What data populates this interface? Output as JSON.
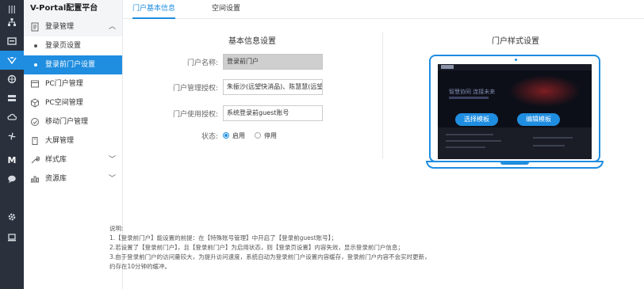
{
  "colors": {
    "accent": "#1f8de0",
    "rail": "#2a313d"
  },
  "rail": {
    "icons": [
      "grid-menu-icon",
      "org-tree-icon",
      "monitor-board-icon",
      "portal-config-icon",
      "network-icon",
      "storage-icon",
      "cloud-icon",
      "fan-icon",
      "m-letter-icon",
      "chat-icon",
      "gear-icon",
      "laptop-icon"
    ],
    "m_label": "M"
  },
  "sidebar": {
    "brand": "V-Portal配置平台",
    "groups": [
      {
        "label": "登录管理",
        "icon": "document-icon",
        "expanded": true,
        "items": [
          {
            "label": "登录页设置"
          },
          {
            "label": "登录前门户设置"
          }
        ]
      },
      {
        "label": "PC门户管理",
        "icon": "box-icon"
      },
      {
        "label": "PC空间管理",
        "icon": "cube-icon"
      },
      {
        "label": "移动门户管理",
        "icon": "mobile-icon"
      },
      {
        "label": "大屏管理",
        "icon": "screen-icon"
      },
      {
        "label": "样式库",
        "icon": "wrench-icon",
        "chevron": "﹀"
      },
      {
        "label": "资源库",
        "icon": "bar-chart-icon",
        "chevron": "﹀"
      }
    ],
    "chevron_up": "︿"
  },
  "tabs": [
    {
      "label": "门户基本信息",
      "active": true
    },
    {
      "label": "空间设置",
      "active": false
    }
  ],
  "basic": {
    "title": "基本信息设置",
    "fields": [
      {
        "label": "门户名称:",
        "value": "登录前门户",
        "disabled": true
      },
      {
        "label": "门户管理授权:",
        "value": "朱振沙(远望快消品)、陈慧慧(远望快",
        "disabled": false
      },
      {
        "label": "门户使用授权:",
        "value": "系统登录前guest账号",
        "disabled": false
      }
    ],
    "status_label": "状态:",
    "status_options": [
      {
        "label": "启用",
        "selected": true
      },
      {
        "label": "停用",
        "selected": false
      }
    ]
  },
  "style": {
    "title": "门户样式设置",
    "select_template": "选择模板",
    "edit_template": "编辑模板",
    "preview_headline": "智慧协同 连接未来"
  },
  "notes": {
    "title": "说明:",
    "lines": [
      "1.【登录前门户】能设置的前提：在【特殊账号管理】中开启了【登录前guest账号】；",
      "2.若设置了【登录前门户】，且【登录前门户】为启用状态，则【登录页设置】内容失效，显示登录前门户信息；",
      "3.由于登录前门户的访问量较大，为提升访问速度，系统自动为登录前门户设置内容缓存，登录前门户内容不会实时更新，",
      "约存在10分钟的缓冲。"
    ]
  }
}
